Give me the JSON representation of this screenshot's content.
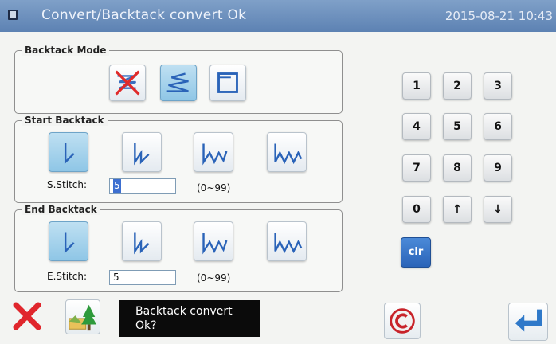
{
  "window": {
    "title": "Convert/Backtack convert Ok",
    "datetime": "2015-08-21 10:43"
  },
  "backtack_mode": {
    "legend": "Backtack Mode",
    "options": [
      "backtack-off",
      "backtack-convert",
      "backtack-block"
    ],
    "selected": "backtack-convert"
  },
  "start_backtack": {
    "legend": "Start Backtack",
    "options": [
      "1-stitch",
      "2-stitch",
      "3-stitch",
      "4-stitch"
    ],
    "selected": "1-stitch",
    "stitch_label": "S.Stitch:",
    "stitch_value": "5",
    "range": "(0~99)"
  },
  "end_backtack": {
    "legend": "End Backtack",
    "options": [
      "1-stitch",
      "2-stitch",
      "3-stitch",
      "4-stitch"
    ],
    "selected": "1-stitch",
    "stitch_label": "E.Stitch:",
    "stitch_value": "5",
    "range": "(0~99)"
  },
  "keypad": {
    "keys": [
      "1",
      "2",
      "3",
      "4",
      "5",
      "6",
      "7",
      "8",
      "9",
      "0",
      "↑",
      "↓"
    ],
    "clear_label": "clr"
  },
  "message": {
    "line1": "Backtack convert",
    "line2": "Ok?"
  },
  "colors": {
    "titlebar": "#6d8fbe",
    "tile_active": "#9fcfeb",
    "clear_key": "#2f6cc2",
    "cancel_red": "#e0262c",
    "enter_blue": "#2f79c9"
  }
}
